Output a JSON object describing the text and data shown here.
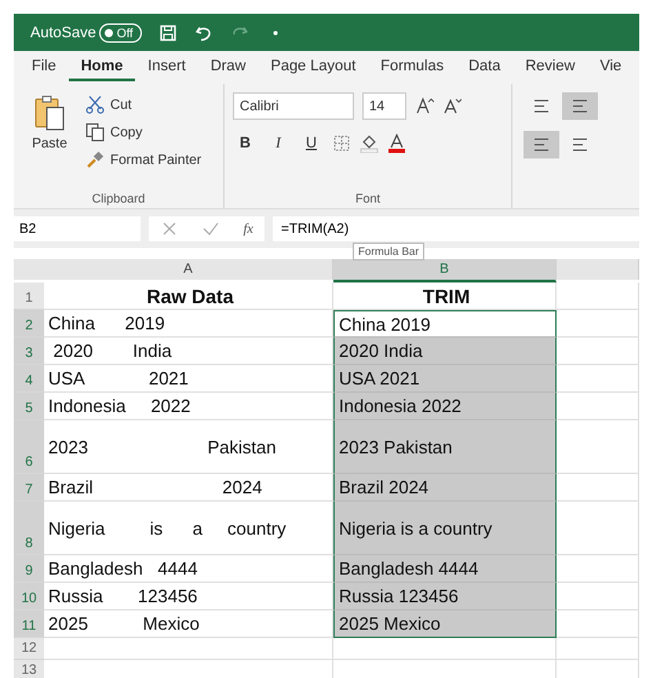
{
  "title_bar": {
    "autosave_label": "AutoSave",
    "autosave_toggle": {
      "label": "Off",
      "on": false
    }
  },
  "tabs": [
    {
      "label": "File",
      "selected": false
    },
    {
      "label": "Home",
      "selected": true
    },
    {
      "label": "Insert",
      "selected": false
    },
    {
      "label": "Draw",
      "selected": false
    },
    {
      "label": "Page Layout",
      "selected": false
    },
    {
      "label": "Formulas",
      "selected": false
    },
    {
      "label": "Data",
      "selected": false
    },
    {
      "label": "Review",
      "selected": false
    },
    {
      "label": "Vie",
      "selected": false
    }
  ],
  "clipboard": {
    "paste": "Paste",
    "cut": "Cut",
    "copy": "Copy",
    "format_painter": "Format Painter",
    "group_label": "Clipboard"
  },
  "font": {
    "name": "Calibri",
    "size": "14",
    "group_label": "Font",
    "bold": "B",
    "italic": "I",
    "underline": "U"
  },
  "alignment": {
    "top_selected": false,
    "middle_selected": true,
    "left_selected": true,
    "center_selected": false
  },
  "formula_bar": {
    "name_box": "B2",
    "fx": "fx",
    "formula": "=TRIM(A2)",
    "tooltip": "Formula Bar"
  },
  "columns": [
    {
      "label": "A",
      "selected": false
    },
    {
      "label": "B",
      "selected": true
    }
  ],
  "rows": [
    {
      "number": "1",
      "a": "Raw Data",
      "b": "TRIM",
      "header": true,
      "wrapped": false,
      "selected": false,
      "active": false
    },
    {
      "number": "2",
      "a": "China      2019",
      "b": "China 2019",
      "header": false,
      "wrapped": false,
      "selected": true,
      "active": true
    },
    {
      "number": "3",
      "a": " 2020        India",
      "b": "2020 India",
      "header": false,
      "wrapped": false,
      "selected": true,
      "active": false
    },
    {
      "number": "4",
      "a": "USA             2021",
      "b": "USA 2021",
      "header": false,
      "wrapped": false,
      "selected": true,
      "active": false
    },
    {
      "number": "5",
      "a": "Indonesia     2022",
      "b": "Indonesia 2022",
      "header": false,
      "wrapped": false,
      "selected": true,
      "active": false
    },
    {
      "number": "6",
      "a": "2023                        Pakistan",
      "b": "2023 Pakistan",
      "header": false,
      "wrapped": true,
      "selected": true,
      "active": false
    },
    {
      "number": "7",
      "a": "Brazil                          2024",
      "b": "Brazil 2024",
      "header": false,
      "wrapped": false,
      "selected": true,
      "active": false
    },
    {
      "number": "8",
      "a": "Nigeria         is      a     country",
      "b": "Nigeria is a country",
      "header": false,
      "wrapped": true,
      "selected": true,
      "active": false
    },
    {
      "number": "9",
      "a": "Bangladesh   4444",
      "b": "Bangladesh 4444",
      "header": false,
      "wrapped": false,
      "selected": true,
      "active": false
    },
    {
      "number": "10",
      "a": "Russia       123456",
      "b": "Russia 123456",
      "header": false,
      "wrapped": false,
      "selected": true,
      "active": false
    },
    {
      "number": "11",
      "a": "2025           Mexico",
      "b": "2025 Mexico",
      "header": false,
      "wrapped": false,
      "selected": true,
      "active": false
    },
    {
      "number": "12",
      "selected": false,
      "active": false
    },
    {
      "number": "13",
      "selected": false,
      "active": false
    }
  ]
}
